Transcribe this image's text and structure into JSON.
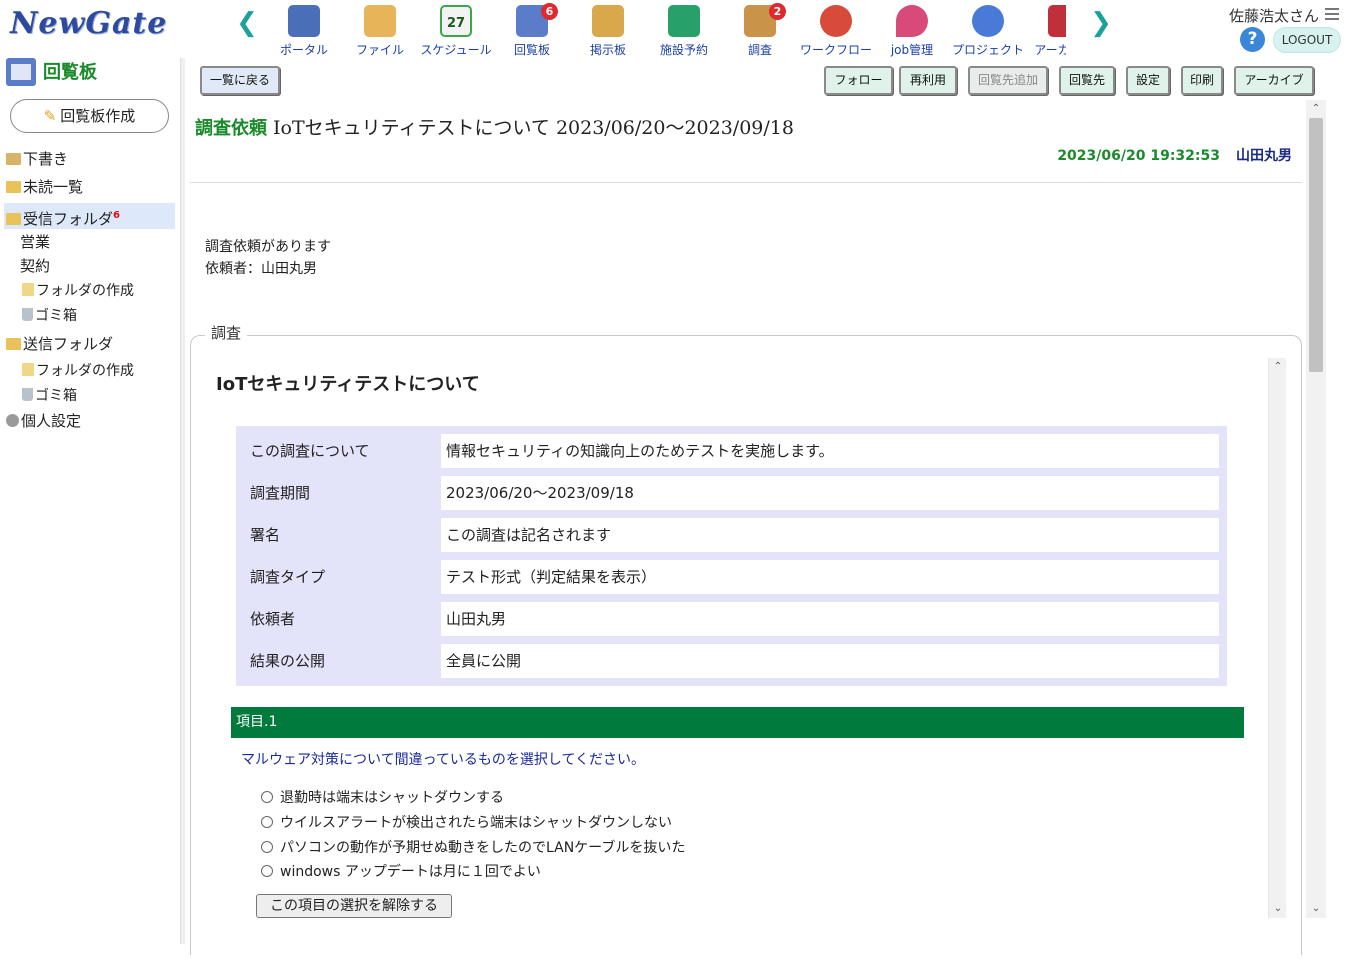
{
  "header": {
    "logo": "NewGate",
    "user_name": "佐藤浩太さん",
    "logout_label": "LOGOUT",
    "help_label": "?",
    "nav_prev": "❮",
    "nav_next": "❯",
    "apps": [
      {
        "label": "ポータル",
        "icon": "portal-icon",
        "color": "#4a6fb8",
        "badge": ""
      },
      {
        "label": "ファイル",
        "icon": "file-folder-icon",
        "color": "#e8b45a",
        "badge": ""
      },
      {
        "label": "スケジュール",
        "icon": "calendar-icon",
        "color": "#3aa84a",
        "badge": "",
        "icon_text": "27"
      },
      {
        "label": "回覧板",
        "icon": "circular-board-icon",
        "color": "#5b7cc9",
        "badge": "6"
      },
      {
        "label": "掲示板",
        "icon": "bulletin-board-icon",
        "color": "#d9a84a",
        "badge": ""
      },
      {
        "label": "施設予約",
        "icon": "facility-icon",
        "color": "#27a06a",
        "badge": ""
      },
      {
        "label": "調査",
        "icon": "survey-clipboard-icon",
        "color": "#c9944a",
        "badge": "2"
      },
      {
        "label": "ワークフロー",
        "icon": "approved-stamp-icon",
        "color": "#d84a3a",
        "badge": ""
      },
      {
        "label": "job管理",
        "icon": "job-pin-icon",
        "color": "#d84a7a",
        "badge": ""
      },
      {
        "label": "プロジェクト",
        "icon": "project-network-icon",
        "color": "#4a7ad8",
        "badge": ""
      },
      {
        "label": "アーカイブ",
        "icon": "archive-binders-icon",
        "color": "#c0303a",
        "badge": ""
      }
    ]
  },
  "sidebar": {
    "title": "回覧板",
    "create_label": "回覧板作成",
    "items": [
      {
        "label": "下書き",
        "icon": "draft-icon"
      },
      {
        "label": "未読一覧",
        "icon": "unread-folder-icon"
      },
      {
        "label": "受信フォルダ",
        "icon": "inbox-folder-icon",
        "count": "6"
      },
      {
        "label": "営業"
      },
      {
        "label": "契約"
      },
      {
        "label": "フォルダの作成",
        "icon": "new-folder-icon"
      },
      {
        "label": "ゴミ箱",
        "icon": "trash-icon"
      },
      {
        "label": "送信フォルダ",
        "icon": "sent-folder-icon"
      },
      {
        "label": "フォルダの作成",
        "icon": "new-folder-icon"
      },
      {
        "label": "ゴミ箱",
        "icon": "trash-icon"
      },
      {
        "label": "個人設定",
        "icon": "gear-icon"
      }
    ]
  },
  "toolbar": {
    "back_label": "一覧に戻る",
    "follow_label": "フォロー",
    "reuse_label": "再利用",
    "add_recipient_label": "回覧先追加",
    "recipients_label": "回覧先",
    "settings_label": "設定",
    "print_label": "印刷",
    "archive_label": "アーカイブ"
  },
  "message": {
    "kind": "調査依頼",
    "title": "IoTセキュリティテストについて 2023/06/20～2023/09/18",
    "datetime": "2023/06/20 19:32:53",
    "author": "山田丸男",
    "body_line1": "調査依頼があります",
    "body_line2": "依頼者：山田丸男"
  },
  "survey": {
    "legend": "調査",
    "heading": "IoTセキュリティテストについて",
    "info": [
      {
        "key": "この調査について",
        "value": "情報セキュリティの知識向上のためテストを実施します。"
      },
      {
        "key": "調査期間",
        "value": "2023/06/20～2023/09/18"
      },
      {
        "key": "署名",
        "value": "この調査は記名されます"
      },
      {
        "key": "調査タイプ",
        "value": "テスト形式（判定結果を表示）"
      },
      {
        "key": "依頼者",
        "value": "山田丸男"
      },
      {
        "key": "結果の公開",
        "value": "全員に公開"
      }
    ],
    "question": {
      "header": "項目.1",
      "text": "マルウェア対策について間違っているものを選択してください。",
      "options": [
        "退勤時は端末はシャットダウンする",
        "ウイルスアラートが検出されたら端末はシャットダウンしない",
        "パソコンの動作が予期せぬ動きをしたのでLANケーブルを抜いた",
        "windows アップデートは月に１回でよい"
      ],
      "clear_label": "この項目の選択を解除する"
    }
  },
  "scroll": {
    "up": "⌃",
    "down": "⌄"
  }
}
